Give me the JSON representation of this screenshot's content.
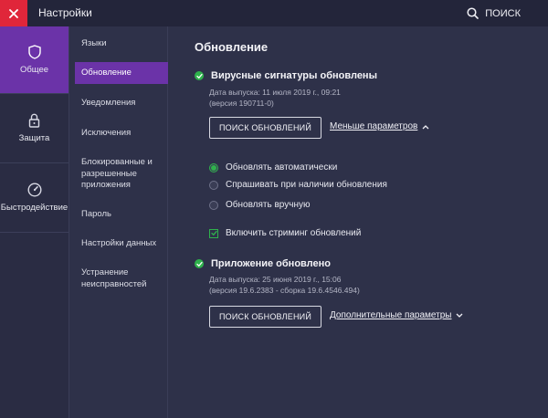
{
  "window": {
    "title": "Настройки",
    "search_label": "ПОИСК"
  },
  "left_nav": [
    {
      "label": "Общее",
      "icon": "shield-icon",
      "active": true
    },
    {
      "label": "Защита",
      "icon": "lock-icon",
      "active": false
    },
    {
      "label": "Быстродействие",
      "icon": "speedometer-icon",
      "active": false
    }
  ],
  "sub_nav": [
    {
      "label": "Языки"
    },
    {
      "label": "Обновление",
      "active": true
    },
    {
      "label": "Уведомления"
    },
    {
      "label": "Исключения"
    },
    {
      "label": "Блокированные и разрешенные приложения"
    },
    {
      "label": "Пароль"
    },
    {
      "label": "Настройки данных"
    },
    {
      "label": "Устранение неисправностей"
    }
  ],
  "main": {
    "heading": "Обновление",
    "signatures": {
      "title": "Вирусные сигнатуры обновлены",
      "release_line": "Дата выпуска: 11 июля 2019 г., 09:21",
      "version_line": "(версия 190711-0)",
      "check_button": "ПОИСК ОБНОВЛЕНИЙ",
      "toggle_link": "Меньше параметров",
      "options": [
        {
          "label": "Обновлять автоматически",
          "selected": true
        },
        {
          "label": "Спрашивать при наличии обновления",
          "selected": false
        },
        {
          "label": "Обновлять вручную",
          "selected": false
        }
      ],
      "streaming_label": "Включить стриминг обновлений",
      "streaming_checked": true
    },
    "application": {
      "title": "Приложение обновлено",
      "release_line": "Дата выпуска: 25 июня 2019 г., 15:06",
      "version_line": "(версия 19.6.2383 - сборка 19.6.4546.494)",
      "check_button": "ПОИСК ОБНОВЛЕНИЙ",
      "more_link": "Дополнительные параметры"
    }
  },
  "colors": {
    "accent": "#6b33a8",
    "close": "#e0263a",
    "success": "#2fb24c"
  }
}
